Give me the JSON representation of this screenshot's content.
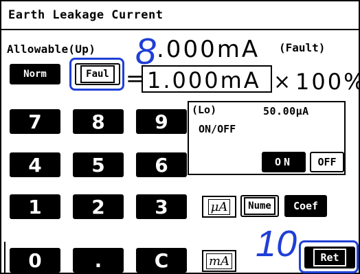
{
  "window": {
    "title": "Earth Leakage Current"
  },
  "header": {
    "allowable_label": "Allowable(Up)",
    "main_value": ".000mA",
    "fault_label": "(Fault)"
  },
  "callouts": {
    "eight": "8",
    "ten": "10"
  },
  "mode_buttons": {
    "norm_label": "Norm",
    "faul_label": "Faul"
  },
  "formula": {
    "equals": "=",
    "value": "1.000mA",
    "times": "×",
    "percent": "100%"
  },
  "keypad": {
    "k7": "7",
    "k8": "8",
    "k9": "9",
    "k4": "4",
    "k5": "5",
    "k6": "6",
    "k1": "1",
    "k2": "2",
    "k3": "3",
    "k0": "0",
    "kdot": ".",
    "kc": "C"
  },
  "lo_panel": {
    "label": "(Lo)",
    "value": "50.00μA",
    "onoff_label": "ON/OFF",
    "on_button": "ON",
    "off_button": "OFF"
  },
  "unit_buttons": {
    "ua_label": "μA",
    "ma_label": "mA"
  },
  "function_buttons": {
    "nume_label": "Nume",
    "coef_label": "Coef",
    "ret_label": "Ret"
  }
}
